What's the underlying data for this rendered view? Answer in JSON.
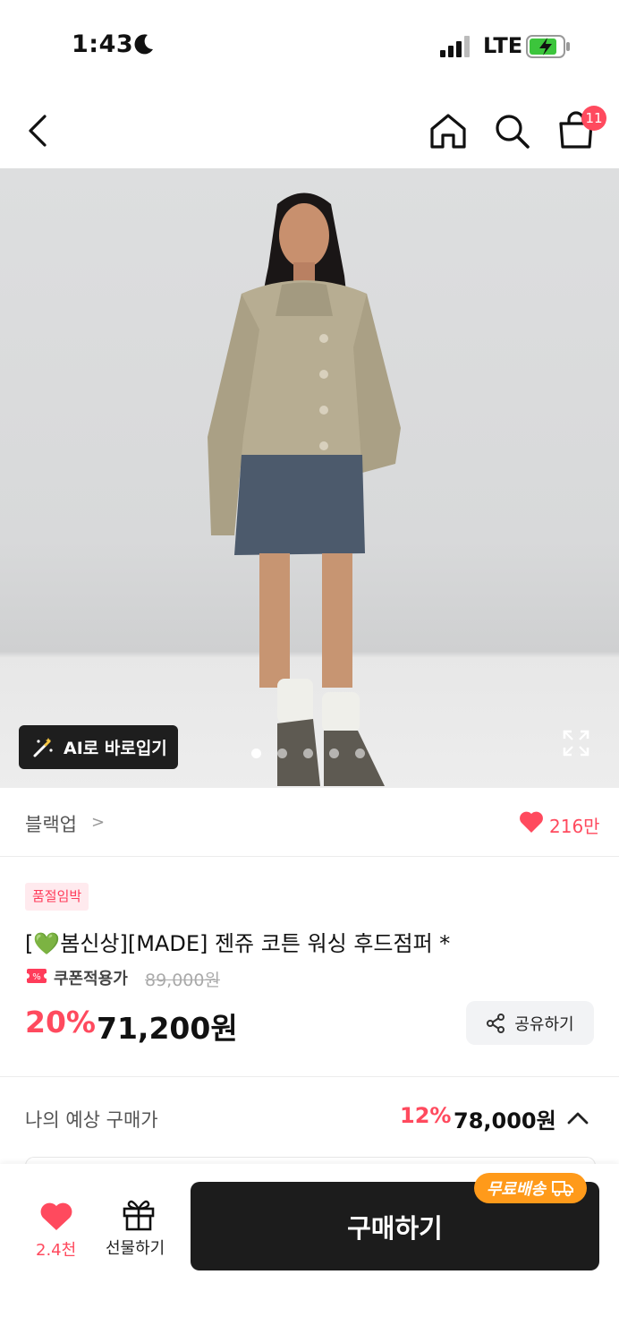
{
  "status_bar": {
    "time": "1:43",
    "network": "LTE"
  },
  "nav": {
    "cart_count": "11"
  },
  "hero": {
    "ai_button_label": "AI로 바로입기",
    "image_count": 5,
    "active_index": 0
  },
  "brand": {
    "name": "블랙업",
    "chevron": ">",
    "like_count": "216만"
  },
  "product": {
    "tag": "품절임박",
    "title": "[💚봄신상][MADE] 젠쥬 코튼 워싱 후드점퍼 *",
    "coupon_label": "쿠폰적용가",
    "original_price": "89,000원",
    "discount": "20%",
    "price": "71,200원",
    "share_label": "공유하기"
  },
  "estimate": {
    "label": "나의 예상 구매가",
    "discount": "12%",
    "price": "78,000원"
  },
  "bottom": {
    "likes": "2.4천",
    "gift_label": "선물하기",
    "buy_label": "구매하기",
    "free_shipping": "무료배송"
  },
  "colors": {
    "accent": "#ff4a5e",
    "buy_button": "#1c1c1c",
    "free_shipping": "#ff9a1a"
  }
}
